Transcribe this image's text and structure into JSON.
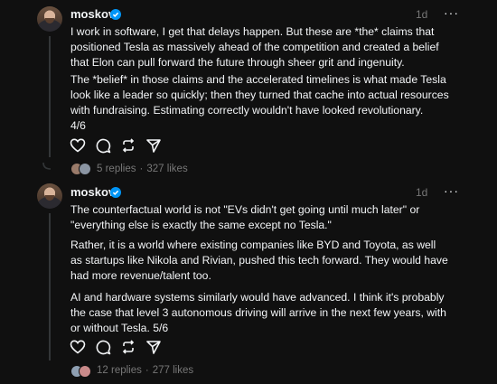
{
  "posts": [
    {
      "username": "moskov",
      "time": "1d",
      "more_label": "···",
      "paragraphs": [
        "I work in software, I get that delays happen. But these are *the* claims that positioned Tesla as massively ahead of the competition and created a belief that Elon can pull forward the future through sheer grit and ingenuity.",
        "The *belief* in those claims and the accelerated timelines is what made Tesla look like a leader so quickly; then they turned that cache into actual resources with fundraising. Estimating correctly wouldn't have looked revolutionary.\n 4/6"
      ],
      "replies": "5 replies",
      "likes": "327 likes",
      "sep": "·"
    },
    {
      "username": "moskov",
      "time": "1d",
      "more_label": "···",
      "paragraphs": [
        "The counterfactual world is not \"EVs didn't get going until much later\" or \"everything else is exactly the same except no Tesla.\"",
        "Rather, it is a world where existing companies like BYD and Toyota, as well as startups like Nikola and Rivian, pushed this tech forward. They would have had more revenue/talent too.",
        "AI and hardware systems similarly would have advanced. I think it's probably the case that level 3 autonomous driving will arrive in the next few years, with or without Tesla. 5/6"
      ],
      "replies": "12 replies",
      "likes": "277 likes",
      "sep": "·"
    }
  ],
  "colors": {
    "background": "#101010",
    "text": "#f3f5f7",
    "muted": "#777777",
    "verified": "#0095f6"
  },
  "icons": [
    "heart-icon",
    "comment-icon",
    "repost-icon",
    "share-icon",
    "verified-icon"
  ]
}
